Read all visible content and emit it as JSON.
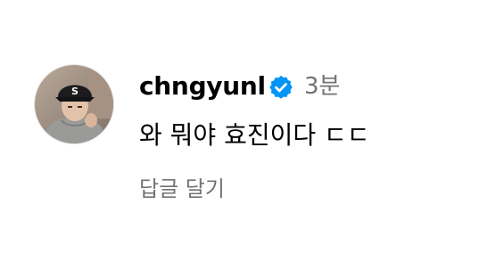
{
  "comment": {
    "username": "chngyunl",
    "verified_icon": "verified-badge-icon",
    "timestamp": "3분",
    "text": "와 뭐야 효진이다 ㄷㄷ",
    "reply_label": "답글 달기"
  },
  "colors": {
    "verified_blue": "#0095f6",
    "secondary_text": "#737373",
    "primary_text": "#000000"
  }
}
